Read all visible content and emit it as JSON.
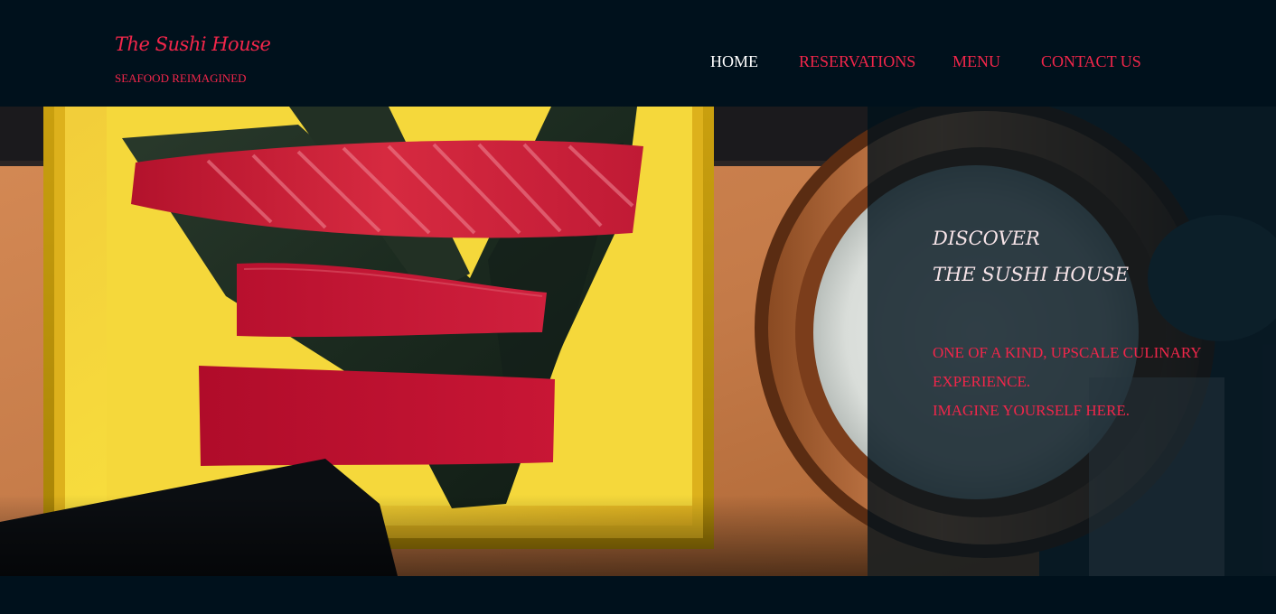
{
  "brand": {
    "name": "The Sushi House",
    "tagline": "SEAFOOD REIMAGINED"
  },
  "nav": {
    "items": [
      {
        "label": "HOME",
        "active": true
      },
      {
        "label": "RESERVATIONS",
        "active": false
      },
      {
        "label": "MENU",
        "active": false
      },
      {
        "label": "CONTACT US",
        "active": false
      }
    ]
  },
  "hero": {
    "heading_line1": "DISCOVER",
    "heading_line2": "THE SUSHI HOUSE",
    "description_line1": "ONE OF A KIND, UPSCALE CULINARY",
    "description_line2": "EXPERIENCE.",
    "description_line3": "IMAGINE YOURSELF HERE."
  },
  "colors": {
    "background": "#00111c",
    "accent": "#f0264a",
    "nav_active": "#ffffff",
    "heading": "#f7e4e8"
  }
}
